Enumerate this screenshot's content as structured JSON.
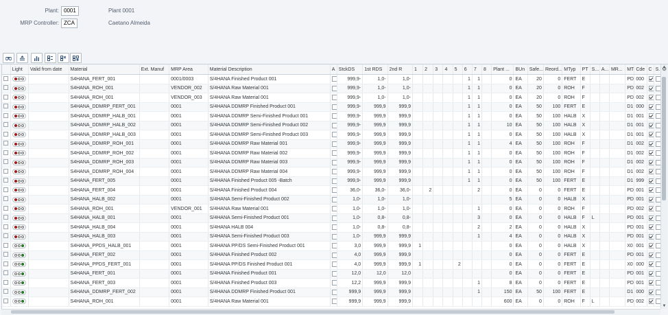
{
  "header": {
    "plant_label": "Plant:",
    "plant_value": "0001",
    "plant_text": "Plant 0001",
    "mrp_label": "MRP Controller:",
    "mrp_value": "ZCA",
    "mrp_text": "Caetano Almeida"
  },
  "toolbar": [
    "binoculars-icon",
    "sort-icon",
    "chart-icon",
    "grid-add-icon",
    "grid-remove-icon",
    "grid-settings-icon"
  ],
  "columns": [
    "",
    "Light",
    "Valid from date",
    "Material",
    "Ext. Manuf",
    "MRP Area",
    "Material Description",
    "A",
    "StckDS",
    "1st RDS",
    "2nd R",
    "1",
    "2",
    "3",
    "4",
    "5",
    "6",
    "7",
    "8",
    "Plant ...",
    "BUn",
    "Safe...",
    "Reord...",
    "MTyp",
    "PT",
    "S...",
    "A...",
    "MR...",
    "MT",
    "Cde",
    "C",
    "S."
  ],
  "rows": [
    {
      "light": "red",
      "material": "S4HANA_FERT_001",
      "area": "0001/0003",
      "desc": "S/4HANA Finished Product 001",
      "stck": "999,9-",
      "rds1": "1,0-",
      "rds2": "1,0-",
      "p1": "",
      "p2": "",
      "p3": "",
      "p4": "",
      "p5": "",
      "p6": "1",
      "p7": "1",
      "p8": "",
      "plant": "0",
      "bun": "EA",
      "safe": "20",
      "reord": "0",
      "mtyp": "FERT",
      "pt": "E",
      "s": "",
      "a": "",
      "mr": "",
      "mt": "PD",
      "cde": "000",
      "c": true
    },
    {
      "light": "red",
      "material": "S4HANA_ROH_001",
      "area": "VENDOR_002",
      "desc": "S/4HANA Raw Material 001",
      "stck": "999,9-",
      "rds1": "1,0-",
      "rds2": "1,0-",
      "p1": "",
      "p2": "",
      "p3": "",
      "p4": "",
      "p5": "",
      "p6": "1",
      "p7": "1",
      "p8": "",
      "plant": "0",
      "bun": "EA",
      "safe": "20",
      "reord": "0",
      "mtyp": "ROH",
      "pt": "F",
      "s": "",
      "a": "",
      "mr": "",
      "mt": "PD",
      "cde": "002",
      "c": true
    },
    {
      "light": "red",
      "material": "S4HANA_ROH_001",
      "area": "VENDOR_003",
      "desc": "S/4HANA Raw Material 001",
      "stck": "999,9-",
      "rds1": "1,0-",
      "rds2": "1,0-",
      "p1": "",
      "p2": "",
      "p3": "",
      "p4": "",
      "p5": "",
      "p6": "1",
      "p7": "1",
      "p8": "",
      "plant": "0",
      "bun": "EA",
      "safe": "20",
      "reord": "0",
      "mtyp": "ROH",
      "pt": "F",
      "s": "",
      "a": "",
      "mr": "",
      "mt": "PD",
      "cde": "002",
      "c": true
    },
    {
      "light": "red",
      "material": "S4HANA_DDMRP_FERT_001",
      "area": "0001",
      "desc": "S/4HANA DDMRP Finished Product 001",
      "stck": "999,9-",
      "rds1": "999,9",
      "rds2": "999,9",
      "p1": "",
      "p2": "",
      "p3": "",
      "p4": "",
      "p5": "",
      "p6": "1",
      "p7": "1",
      "p8": "",
      "plant": "0",
      "bun": "EA",
      "safe": "50",
      "reord": "100",
      "mtyp": "FERT",
      "pt": "E",
      "s": "",
      "a": "",
      "mr": "",
      "mt": "D1",
      "cde": "000",
      "c": true
    },
    {
      "light": "red",
      "material": "S4HANA_DDMRP_HALB_001",
      "area": "0001",
      "desc": "S/4HANA DDMRP Semi-Finished Product 001",
      "stck": "999,9-",
      "rds1": "999,9",
      "rds2": "999,9",
      "p1": "",
      "p2": "",
      "p3": "",
      "p4": "",
      "p5": "",
      "p6": "1",
      "p7": "1",
      "p8": "",
      "plant": "0",
      "bun": "EA",
      "safe": "50",
      "reord": "100",
      "mtyp": "HALB",
      "pt": "X",
      "s": "",
      "a": "",
      "mr": "",
      "mt": "D1",
      "cde": "001",
      "c": true
    },
    {
      "light": "red",
      "material": "S4HANA_DDMRP_HALB_002",
      "area": "0001",
      "desc": "S/4HANA DDMRP Semi-Finished Product 002",
      "stck": "999,9-",
      "rds1": "999,9",
      "rds2": "999,9",
      "p1": "",
      "p2": "",
      "p3": "",
      "p4": "",
      "p5": "",
      "p6": "1",
      "p7": "1",
      "p8": "",
      "plant": "10",
      "bun": "EA",
      "safe": "50",
      "reord": "100",
      "mtyp": "HALB",
      "pt": "X",
      "s": "",
      "a": "",
      "mr": "",
      "mt": "D1",
      "cde": "001",
      "c": true
    },
    {
      "light": "red",
      "material": "S4HANA_DDMRP_HALB_003",
      "area": "0001",
      "desc": "S/4HANA DDMRP Semi-Finished Product 003",
      "stck": "999,9-",
      "rds1": "999,9",
      "rds2": "999,9",
      "p1": "",
      "p2": "",
      "p3": "",
      "p4": "",
      "p5": "",
      "p6": "1",
      "p7": "1",
      "p8": "",
      "plant": "0",
      "bun": "EA",
      "safe": "50",
      "reord": "100",
      "mtyp": "HALB",
      "pt": "X",
      "s": "",
      "a": "",
      "mr": "",
      "mt": "D1",
      "cde": "001",
      "c": true
    },
    {
      "light": "red",
      "material": "S4HANA_DDMRP_ROH_001",
      "area": "0001",
      "desc": "S/4HANA DDMRP Raw Material 001",
      "stck": "999,9-",
      "rds1": "999,9",
      "rds2": "999,9",
      "p1": "",
      "p2": "",
      "p3": "",
      "p4": "",
      "p5": "",
      "p6": "1",
      "p7": "1",
      "p8": "",
      "plant": "4",
      "bun": "EA",
      "safe": "50",
      "reord": "100",
      "mtyp": "ROH",
      "pt": "F",
      "s": "",
      "a": "",
      "mr": "",
      "mt": "D1",
      "cde": "002",
      "c": true
    },
    {
      "light": "red",
      "material": "S4HANA_DDMRP_ROH_002",
      "area": "0001",
      "desc": "S/4HANA DDMRP Raw Material 002",
      "stck": "999,9-",
      "rds1": "999,9",
      "rds2": "999,9",
      "p1": "",
      "p2": "",
      "p3": "",
      "p4": "",
      "p5": "",
      "p6": "1",
      "p7": "1",
      "p8": "",
      "plant": "0",
      "bun": "EA",
      "safe": "50",
      "reord": "100",
      "mtyp": "ROH",
      "pt": "F",
      "s": "",
      "a": "",
      "mr": "",
      "mt": "D1",
      "cde": "002",
      "c": true
    },
    {
      "light": "red",
      "material": "S4HANA_DDMRP_ROH_003",
      "area": "0001",
      "desc": "S/4HANA DDMRP Raw Material 003",
      "stck": "999,9-",
      "rds1": "999,9",
      "rds2": "999,9",
      "p1": "",
      "p2": "",
      "p3": "",
      "p4": "",
      "p5": "",
      "p6": "1",
      "p7": "1",
      "p8": "",
      "plant": "0",
      "bun": "EA",
      "safe": "50",
      "reord": "100",
      "mtyp": "ROH",
      "pt": "F",
      "s": "",
      "a": "",
      "mr": "",
      "mt": "D1",
      "cde": "002",
      "c": true
    },
    {
      "light": "red",
      "material": "S4HANA_DDMRP_ROH_004",
      "area": "0001",
      "desc": "S/4HANA DDMRP Raw Material 004",
      "stck": "999,9-",
      "rds1": "999,9",
      "rds2": "999,9",
      "p1": "",
      "p2": "",
      "p3": "",
      "p4": "",
      "p5": "",
      "p6": "1",
      "p7": "1",
      "p8": "",
      "plant": "0",
      "bun": "EA",
      "safe": "50",
      "reord": "100",
      "mtyp": "ROH",
      "pt": "F",
      "s": "",
      "a": "",
      "mr": "",
      "mt": "D1",
      "cde": "002",
      "c": true
    },
    {
      "light": "red",
      "material": "S4HANA_FERT_005",
      "area": "0001",
      "desc": "S/4HANA Finished Product 005 -Batch",
      "stck": "999,9-",
      "rds1": "999,9",
      "rds2": "999,9",
      "p1": "",
      "p2": "",
      "p3": "",
      "p4": "",
      "p5": "",
      "p6": "1",
      "p7": "1",
      "p8": "",
      "plant": "0",
      "bun": "EA",
      "safe": "50",
      "reord": "100",
      "mtyp": "FERT",
      "pt": "E",
      "s": "",
      "a": "",
      "mr": "",
      "mt": "D1",
      "cde": "999",
      "c": true
    },
    {
      "light": "red",
      "material": "S4HANA_FERT_004",
      "area": "0001",
      "desc": "S/4HANA Finished Product 004",
      "stck": "36,0-",
      "rds1": "36,0-",
      "rds2": "36,0-",
      "p1": "",
      "p2": "2",
      "p3": "",
      "p4": "",
      "p5": "",
      "p6": "",
      "p7": "2",
      "p8": "",
      "plant": "0",
      "bun": "EA",
      "safe": "0",
      "reord": "0",
      "mtyp": "FERT",
      "pt": "E",
      "s": "",
      "a": "",
      "mr": "",
      "mt": "PD",
      "cde": "001",
      "c": true
    },
    {
      "light": "red",
      "material": "S4HANA_HALB_002",
      "area": "0001",
      "desc": "S/4HANA Semi-Finished Product 002",
      "stck": "1,0-",
      "rds1": "1,0-",
      "rds2": "1,0-",
      "p1": "",
      "p2": "",
      "p3": "",
      "p4": "",
      "p5": "",
      "p6": "",
      "p7": "",
      "p8": "",
      "plant": "5",
      "bun": "EA",
      "safe": "0",
      "reord": "0",
      "mtyp": "HALB",
      "pt": "X",
      "s": "",
      "a": "",
      "mr": "",
      "mt": "PD",
      "cde": "001",
      "c": true
    },
    {
      "light": "red",
      "material": "S4HANA_ROH_001",
      "area": "VENDOR_001",
      "desc": "S/4HANA Raw Material 001",
      "stck": "1,0-",
      "rds1": "1,0-",
      "rds2": "1,0-",
      "p1": "",
      "p2": "",
      "p3": "",
      "p4": "",
      "p5": "",
      "p6": "",
      "p7": "1",
      "p8": "",
      "plant": "0",
      "bun": "EA",
      "safe": "0",
      "reord": "0",
      "mtyp": "ROH",
      "pt": "F",
      "s": "",
      "a": "",
      "mr": "",
      "mt": "PD",
      "cde": "002",
      "c": true
    },
    {
      "light": "red",
      "material": "S4HANA_HALB_001",
      "area": "0001",
      "desc": "S/4HANA Semi-Finished Product 001",
      "stck": "1,0-",
      "rds1": "0,8-",
      "rds2": "0,8-",
      "p1": "",
      "p2": "",
      "p3": "",
      "p4": "",
      "p5": "",
      "p6": "",
      "p7": "3",
      "p8": "",
      "plant": "0",
      "bun": "EA",
      "safe": "0",
      "reord": "0",
      "mtyp": "HALB",
      "pt": "F",
      "s": "L",
      "a": "",
      "mr": "",
      "mt": "PD",
      "cde": "001",
      "c": true
    },
    {
      "light": "red",
      "material": "S4HANA_HALB_004",
      "area": "0001",
      "desc": "S/4HANA HALB 004",
      "stck": "1,0-",
      "rds1": "0,8-",
      "rds2": "0,8-",
      "p1": "",
      "p2": "",
      "p3": "",
      "p4": "",
      "p5": "",
      "p6": "",
      "p7": "2",
      "p8": "",
      "plant": "2",
      "bun": "EA",
      "safe": "0",
      "reord": "0",
      "mtyp": "HALB",
      "pt": "X",
      "s": "",
      "a": "",
      "mr": "",
      "mt": "PD",
      "cde": "001",
      "c": true
    },
    {
      "light": "red",
      "material": "S4HANA_HALB_003",
      "area": "0001",
      "desc": "S/4HANA Semi-Finished Product 003",
      "stck": "1,0-",
      "rds1": "999,9",
      "rds2": "999,9",
      "p1": "",
      "p2": "",
      "p3": "",
      "p4": "",
      "p5": "",
      "p6": "",
      "p7": "1",
      "p8": "",
      "plant": "4",
      "bun": "EA",
      "safe": "0",
      "reord": "0",
      "mtyp": "HALB",
      "pt": "X",
      "s": "",
      "a": "",
      "mr": "",
      "mt": "PD",
      "cde": "001",
      "c": true
    },
    {
      "light": "green",
      "material": "S4HANA_PPDS_HALB_001",
      "area": "0001",
      "desc": "S/4HANA PP/DS Semi-Finished Product 001",
      "stck": "3,0",
      "rds1": "999,9",
      "rds2": "999,9",
      "p1": "1",
      "p2": "",
      "p3": "",
      "p4": "",
      "p5": "",
      "p6": "",
      "p7": "",
      "p8": "",
      "plant": "0",
      "bun": "EA",
      "safe": "0",
      "reord": "0",
      "mtyp": "HALB",
      "pt": "X",
      "s": "",
      "a": "",
      "mr": "",
      "mt": "X0",
      "cde": "001",
      "c": true
    },
    {
      "light": "green",
      "material": "S4HANA_FERT_002",
      "area": "0001",
      "desc": "S/4HANA Finished Product 002",
      "stck": "4,0",
      "rds1": "999,9",
      "rds2": "999,9",
      "p1": "",
      "p2": "",
      "p3": "",
      "p4": "",
      "p5": "",
      "p6": "",
      "p7": "",
      "p8": "",
      "plant": "0",
      "bun": "EA",
      "safe": "0",
      "reord": "0",
      "mtyp": "FERT",
      "pt": "E",
      "s": "",
      "a": "",
      "mr": "",
      "mt": "PD",
      "cde": "001",
      "c": true
    },
    {
      "light": "green",
      "material": "S4HANA_PPDS_FERT_001",
      "area": "0001",
      "desc": "S/4HANA PP/DS Finished Product 001",
      "stck": "4,0",
      "rds1": "999,9",
      "rds2": "999,9",
      "p1": "1",
      "p2": "",
      "p3": "",
      "p4": "",
      "p5": "2",
      "p6": "",
      "p7": "",
      "p8": "",
      "plant": "0",
      "bun": "EA",
      "safe": "0",
      "reord": "0",
      "mtyp": "FERT",
      "pt": "E",
      "s": "",
      "a": "",
      "mr": "",
      "mt": "X0",
      "cde": "000",
      "c": true
    },
    {
      "light": "green",
      "material": "S4HANA_FERT_001",
      "area": "0001",
      "desc": "S/4HANA Finished Product 001",
      "stck": "12,0",
      "rds1": "12,0",
      "rds2": "12,0",
      "p1": "",
      "p2": "",
      "p3": "",
      "p4": "",
      "p5": "",
      "p6": "",
      "p7": "",
      "p8": "",
      "plant": "0",
      "bun": "EA",
      "safe": "0",
      "reord": "0",
      "mtyp": "FERT",
      "pt": "E",
      "s": "",
      "a": "",
      "mr": "",
      "mt": "PD",
      "cde": "001",
      "c": true
    },
    {
      "light": "green",
      "material": "S4HANA_FERT_003",
      "area": "0001",
      "desc": "S/4HANA Finished Product 003",
      "stck": "12,2",
      "rds1": "999,9",
      "rds2": "999,9",
      "p1": "",
      "p2": "",
      "p3": "",
      "p4": "",
      "p5": "",
      "p6": "",
      "p7": "1",
      "p8": "",
      "plant": "8",
      "bun": "EA",
      "safe": "0",
      "reord": "0",
      "mtyp": "FERT",
      "pt": "E",
      "s": "",
      "a": "",
      "mr": "",
      "mt": "PD",
      "cde": "001",
      "c": true
    },
    {
      "light": "green",
      "material": "S4HANA_DDMRP_FERT_002",
      "area": "0001",
      "desc": "S/4HANA DDMRP Finished Product 001",
      "stck": "999,9",
      "rds1": "999,9",
      "rds2": "999,9",
      "p1": "",
      "p2": "",
      "p3": "",
      "p4": "",
      "p5": "",
      "p6": "",
      "p7": "1",
      "p8": "",
      "plant": "150",
      "bun": "EA",
      "safe": "50",
      "reord": "100",
      "mtyp": "FERT",
      "pt": "E",
      "s": "",
      "a": "",
      "mr": "",
      "mt": "D1",
      "cde": "000",
      "c": true
    },
    {
      "light": "green",
      "material": "S4HANA_ROH_001",
      "area": "0001",
      "desc": "S/4HANA Raw Material 001",
      "stck": "999,9",
      "rds1": "999,9",
      "rds2": "999,9",
      "p1": "",
      "p2": "",
      "p3": "",
      "p4": "",
      "p5": "",
      "p6": "",
      "p7": "",
      "p8": "",
      "plant": "600",
      "bun": "EA",
      "safe": "0",
      "reord": "0",
      "mtyp": "ROH",
      "pt": "F",
      "s": "L",
      "a": "",
      "mr": "",
      "mt": "PD",
      "cde": "002",
      "c": true
    }
  ]
}
